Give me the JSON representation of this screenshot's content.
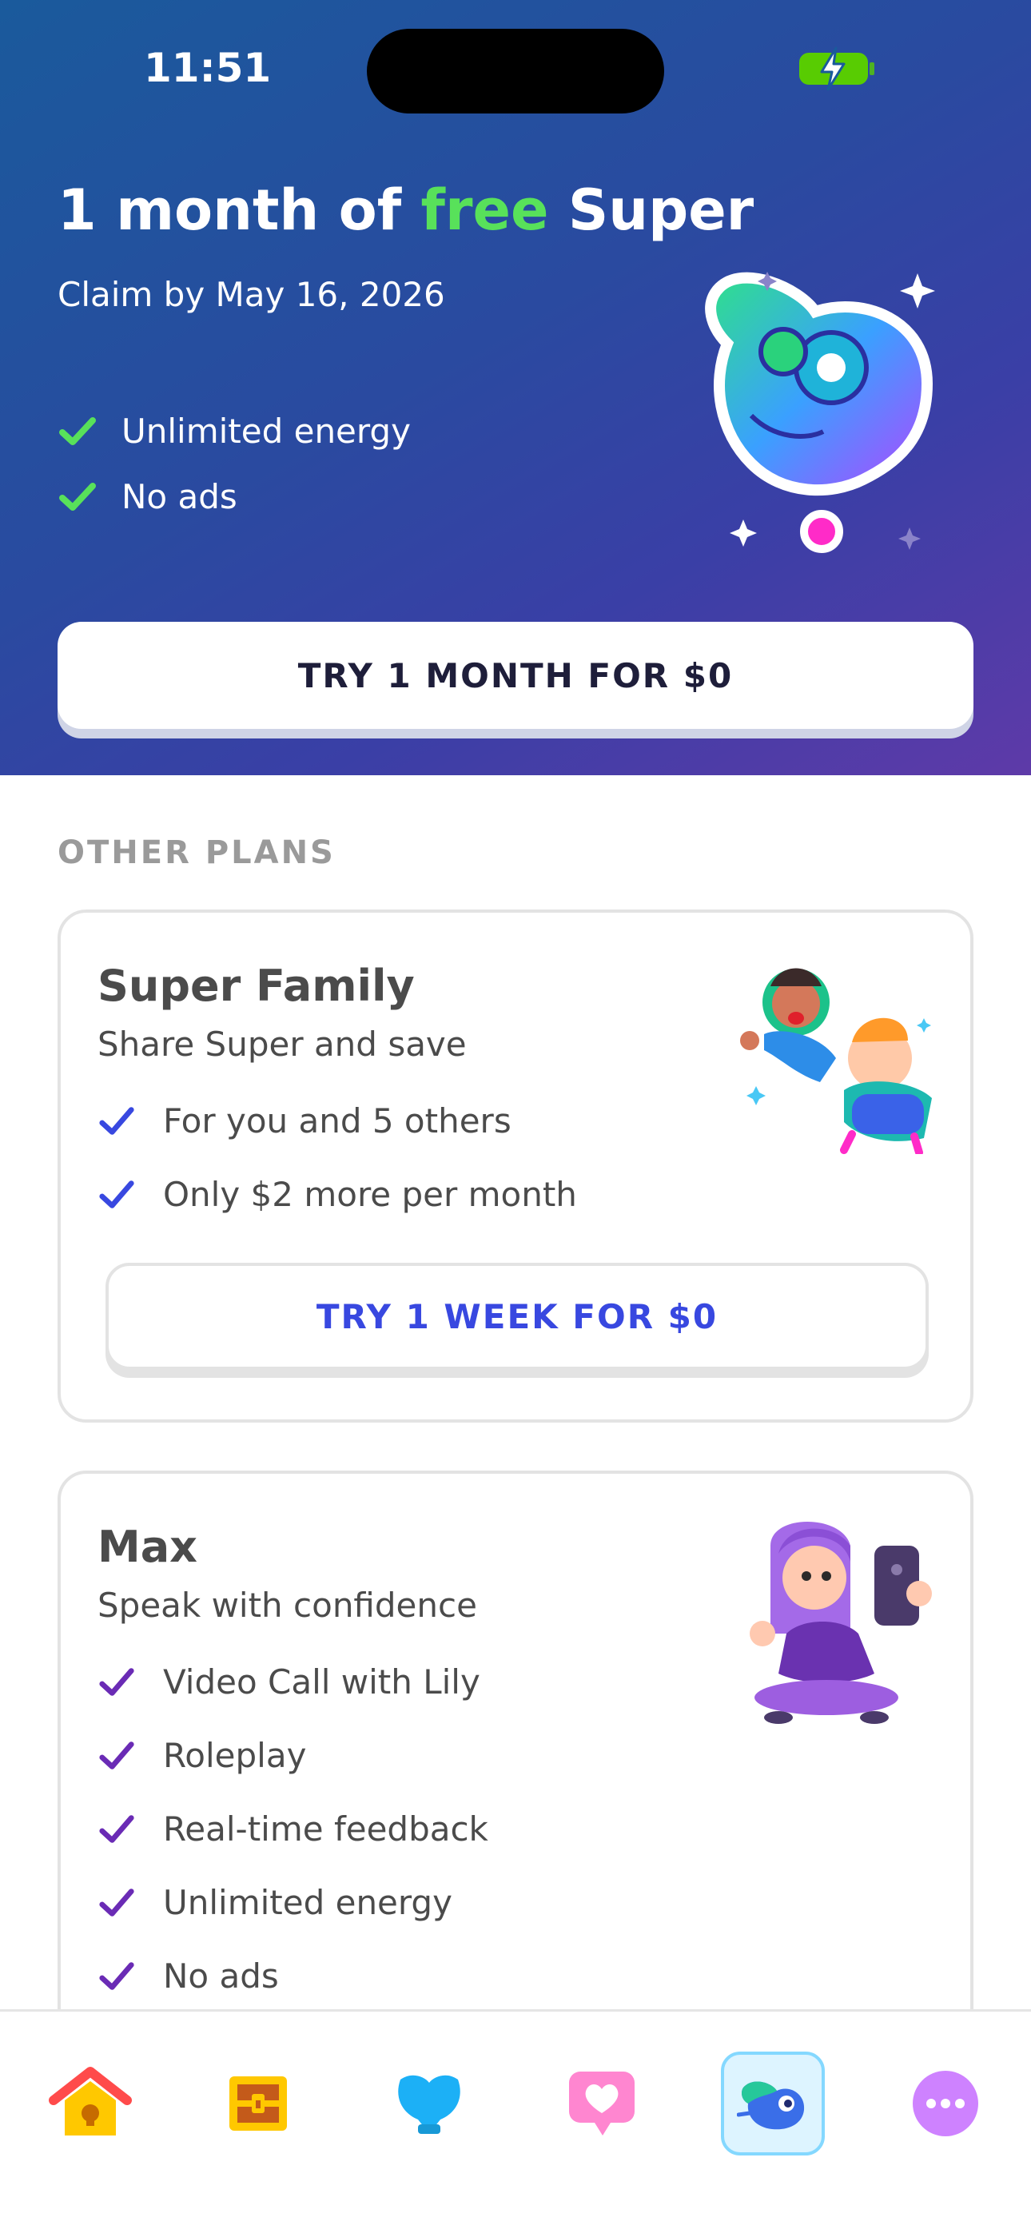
{
  "status_bar": {
    "time": "11:51"
  },
  "hero": {
    "title_part1": "1 month of ",
    "title_highlight": "free",
    "title_part2": " Super",
    "subtitle": "Claim by May 16, 2026",
    "features": [
      "Unlimited energy",
      "No ads"
    ],
    "cta_label": "TRY 1 MONTH FOR $0"
  },
  "other_plans": {
    "section_label": "OTHER PLANS",
    "family": {
      "title": "Super Family",
      "subtitle": "Share Super and save",
      "features": [
        "For you and 5 others",
        "Only $2 more per month"
      ],
      "button_label": "TRY 1 WEEK FOR $0"
    },
    "max": {
      "title": "Max",
      "subtitle": "Speak with confidence",
      "features": [
        "Video Call with Lily",
        "Roleplay",
        "Real-time feedback",
        "Unlimited energy",
        "No ads"
      ]
    }
  },
  "tab_bar": {
    "tabs": [
      {
        "icon": "home-icon"
      },
      {
        "icon": "treasure-chest-icon"
      },
      {
        "icon": "shield-icon"
      },
      {
        "icon": "heart-bubble-icon"
      },
      {
        "icon": "super-owl-icon",
        "active": true
      },
      {
        "icon": "more-icon"
      }
    ]
  },
  "colors": {
    "accent_green": "#58e15a",
    "super_blue": "#3848e0",
    "max_purple": "#6a2bb5",
    "text_dark": "#4b4b4b"
  }
}
